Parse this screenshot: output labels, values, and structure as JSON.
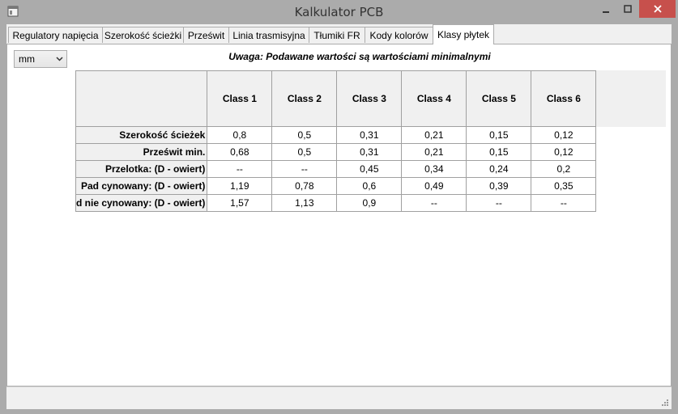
{
  "window": {
    "title": "Kalkulator PCB"
  },
  "tabs": [
    {
      "label": "Regulatory napięcia"
    },
    {
      "label": "Szerokość ścieżki"
    },
    {
      "label": "Prześwit"
    },
    {
      "label": "Linia trasmisyjna"
    },
    {
      "label": "Tłumiki FR"
    },
    {
      "label": "Kody kolorów"
    },
    {
      "label": "Klasy płytek",
      "active": true
    }
  ],
  "unit_select": {
    "value": "mm"
  },
  "notice": "Uwaga: Podawane wartości są wartościami minimalnymi",
  "table": {
    "columns": [
      "Class 1",
      "Class 2",
      "Class 3",
      "Class 4",
      "Class 5",
      "Class 6"
    ],
    "rows": [
      {
        "label": "Szerokość ścieżek",
        "values": [
          "0,8",
          "0,5",
          "0,31",
          "0,21",
          "0,15",
          "0,12"
        ]
      },
      {
        "label": "Prześwit min.",
        "values": [
          "0,68",
          "0,5",
          "0,31",
          "0,21",
          "0,15",
          "0,12"
        ]
      },
      {
        "label": "Przelotka: (D - owiert)",
        "values": [
          "--",
          "--",
          "0,45",
          "0,34",
          "0,24",
          "0,2"
        ]
      },
      {
        "label": "Pad cynowany: (D - owiert)",
        "values": [
          "1,19",
          "0,78",
          "0,6",
          "0,49",
          "0,39",
          "0,35"
        ]
      },
      {
        "label": "d nie cynowany: (D - owiert)",
        "values": [
          "1,57",
          "1,13",
          "0,9",
          "--",
          "--",
          "--"
        ]
      }
    ]
  },
  "colors": {
    "close_button": "#c7504c",
    "frame": "#ababab",
    "panel": "#ffffff"
  }
}
